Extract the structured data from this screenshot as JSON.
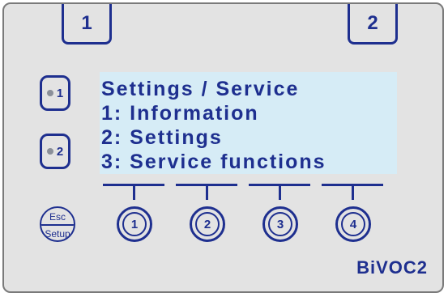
{
  "top_tabs": {
    "left": "1",
    "right": "2"
  },
  "side_buttons": {
    "one": "1",
    "two": "2"
  },
  "display": {
    "lines": [
      "Settings / Service",
      "1: Information",
      "2: Settings",
      "3: Service functions"
    ]
  },
  "softkeys": [
    "1",
    "2",
    "3",
    "4"
  ],
  "esc_button": {
    "top": "Esc",
    "bottom": "Setup"
  },
  "brand": "BiVOC2",
  "colors": {
    "accent": "#1e2f8f",
    "lcd": "#d6ecf6",
    "panel": "#e3e3e3",
    "led": "#8a8f99"
  }
}
